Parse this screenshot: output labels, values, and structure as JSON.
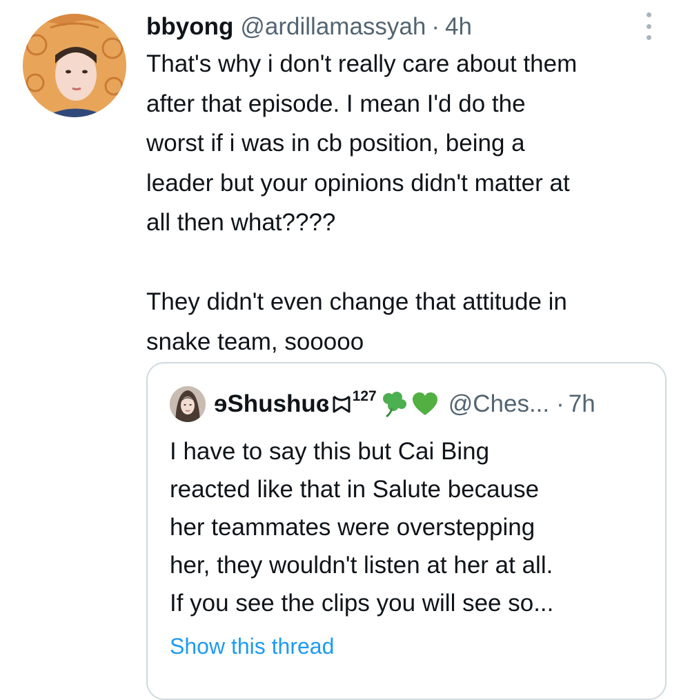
{
  "tweet": {
    "author_name": "bbyong",
    "author_handle": "@ardillamassyah",
    "separator": "·",
    "time": "4h",
    "text_lines": [
      "That's why i don't really care about them",
      "after that episode. I mean I'd do the",
      "worst if i was in cb position, being a",
      "leader but your opinions didn't matter at",
      "all then what????"
    ],
    "text_lines_2": [
      "They didn't even change that attitude in",
      "snake team, sooooo"
    ],
    "avatar_icon": "profile-photo-costume",
    "more_icon": "vertical-ellipsis-icon"
  },
  "quote": {
    "author_name": "ɘShushuɞ",
    "name_suffix_icon": "ribbon-icon",
    "superscript": "127",
    "emojis": [
      "shamrock-icon",
      "green-heart-icon"
    ],
    "author_handle": "@Ches...",
    "separator": "·",
    "time": "7h",
    "text_lines": [
      "I have to say this but Cai Bing",
      "reacted like that in Salute because",
      "her teammates were overstepping",
      "her, they wouldn't listen at her at all.",
      "If you see the clips you will see so..."
    ],
    "show_thread": "Show this thread"
  },
  "colors": {
    "text_primary": "#0f1419",
    "text_secondary": "#536471",
    "link": "#1d9bf0",
    "border": "#cfd9de",
    "shamrock": "#4caf50",
    "heart": "#52b043"
  }
}
